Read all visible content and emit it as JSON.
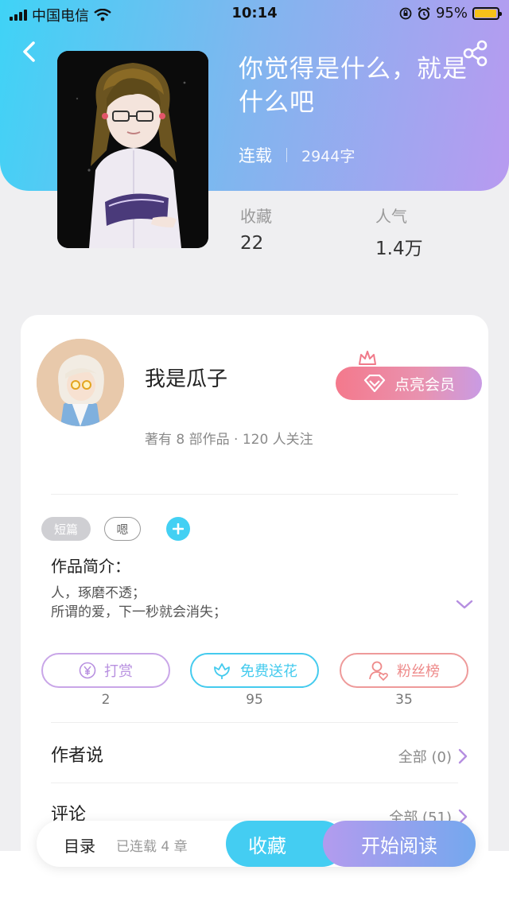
{
  "status_bar": {
    "carrier": "中国电信",
    "time": "10:14",
    "battery": "95%",
    "battery_level": 0.95
  },
  "book": {
    "title": "你觉得是什么，就是什么吧",
    "status": "连载",
    "word_count": "2944字"
  },
  "stats": [
    {
      "label": "收藏",
      "value": "22"
    },
    {
      "label": "人气",
      "value": "1.4万"
    }
  ],
  "author": {
    "name": "我是瓜子",
    "works_info": "著有 8 部作品 · 120 人关注",
    "member_button": "点亮会员"
  },
  "tags": [
    "短篇",
    "嗯"
  ],
  "intro": {
    "title": "作品简介：",
    "lines": [
      "人，琢磨不透；",
      "所谓的爱，下一秒就会消失；"
    ]
  },
  "actions": [
    {
      "label": "打赏",
      "count": "2",
      "color": "#b890e0"
    },
    {
      "label": "免费送花",
      "count": "95",
      "color": "#45cbee"
    },
    {
      "label": "粉丝榜",
      "count": "35",
      "color": "#ee8a8a"
    }
  ],
  "author_says": {
    "title": "作者说",
    "right": "全部 (0)"
  },
  "comments": {
    "title": "评论",
    "right": "全部 (51)"
  },
  "bottom": {
    "toc": "目录",
    "chapters": "已连载 4 章",
    "favorite": "收藏",
    "read": "开始阅读"
  }
}
